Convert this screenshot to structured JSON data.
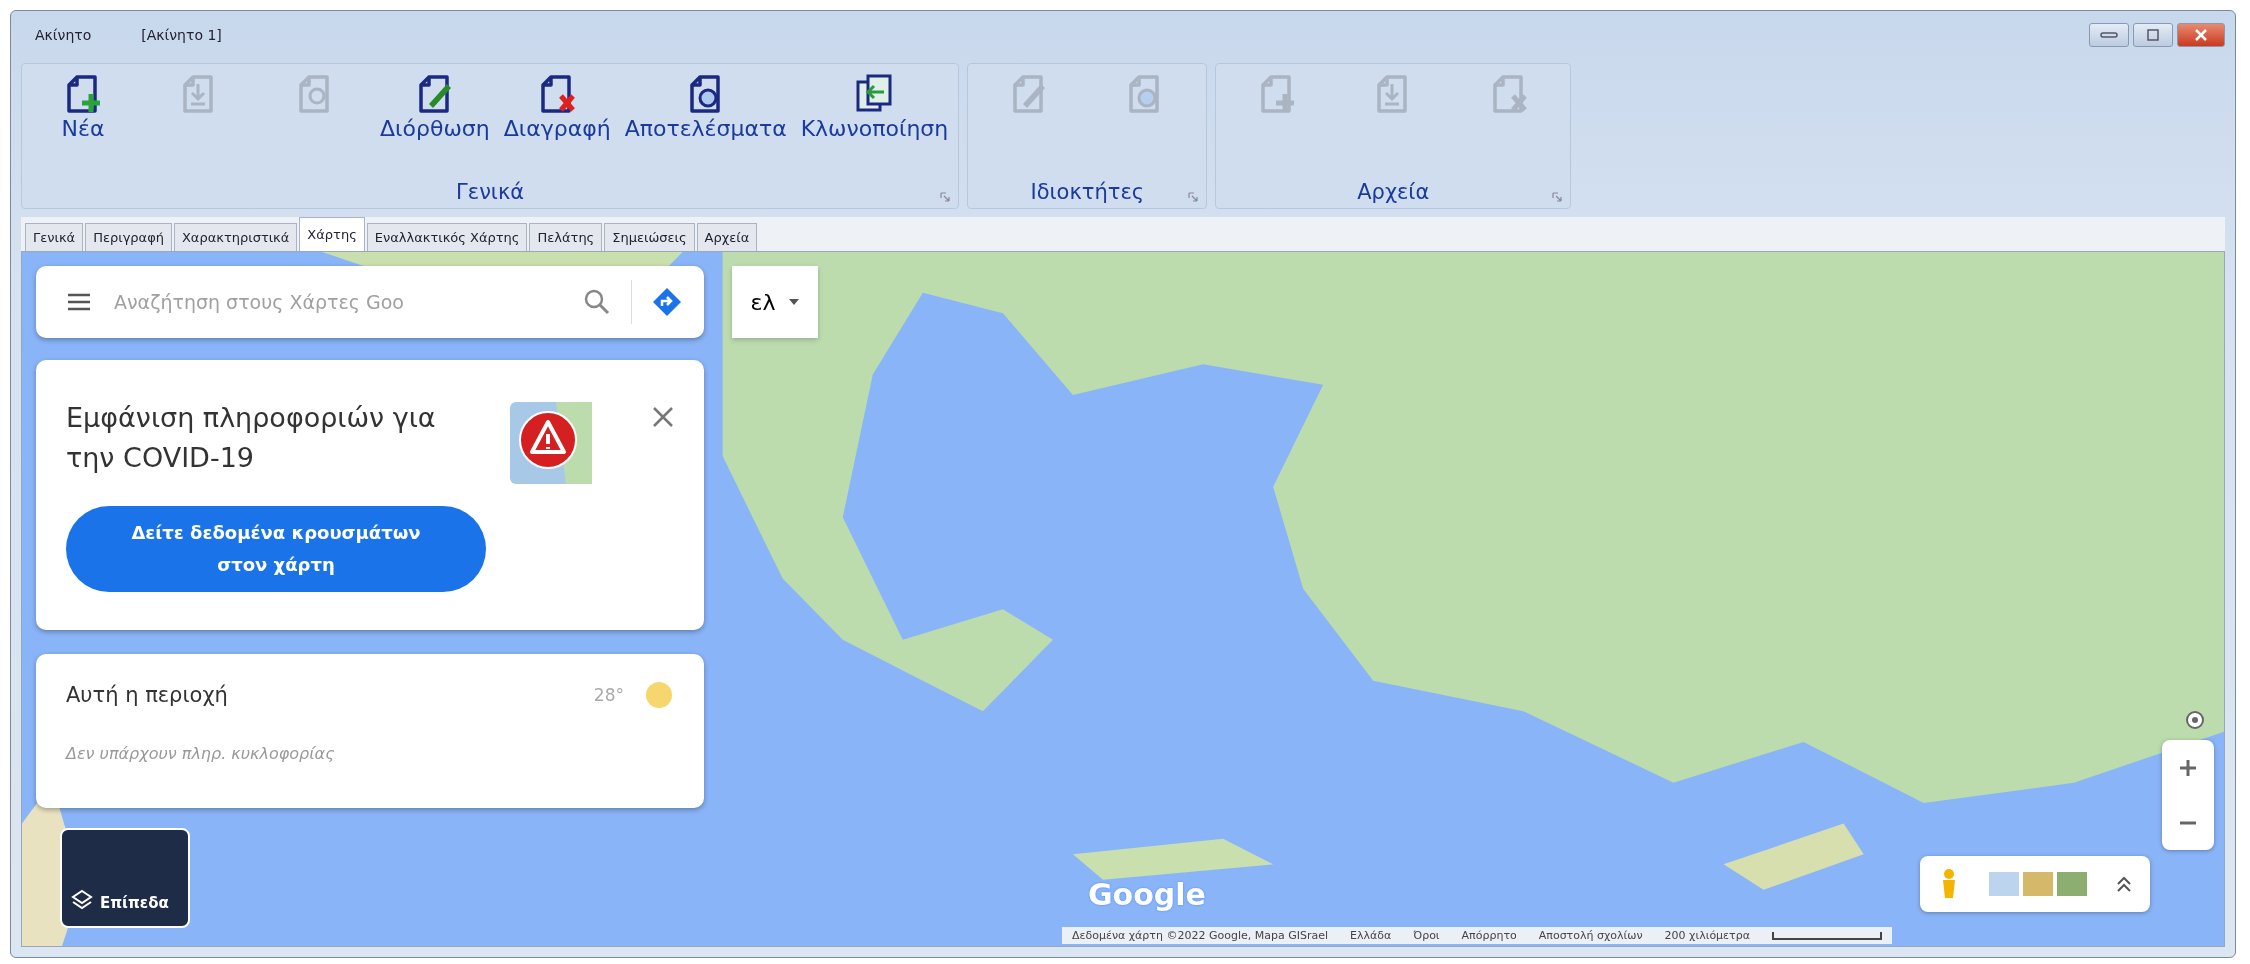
{
  "title_bar": {
    "items": [
      "Ακίνητο",
      "[Ακίνητο 1]"
    ]
  },
  "ribbon": {
    "groups": [
      {
        "label": "Γενικά",
        "buttons": [
          {
            "kind": "new",
            "label": "Νέα",
            "disabled": false
          },
          {
            "kind": "download",
            "disabled": true
          },
          {
            "kind": "cancel",
            "disabled": true
          },
          {
            "kind": "edit",
            "label": "Διόρθωση",
            "disabled": false
          },
          {
            "kind": "delete",
            "label": "Διαγραφή",
            "disabled": false
          },
          {
            "kind": "results",
            "label": "Αποτελέσματα",
            "disabled": false
          },
          {
            "kind": "clone",
            "label": "Κλωνοποίηση",
            "disabled": false
          }
        ]
      },
      {
        "label": "Ιδιοκτήτες",
        "buttons": [
          {
            "kind": "edit",
            "disabled": true
          },
          {
            "kind": "search",
            "disabled": true
          }
        ]
      },
      {
        "label": "Αρχεία",
        "buttons": [
          {
            "kind": "new",
            "disabled": true
          },
          {
            "kind": "download",
            "disabled": true
          },
          {
            "kind": "delete",
            "disabled": true
          }
        ]
      }
    ]
  },
  "tabs": [
    {
      "label": "Γενικά",
      "selected": false
    },
    {
      "label": "Περιγραφή",
      "selected": false
    },
    {
      "label": "Χαρακτηριστικά",
      "selected": false
    },
    {
      "label": "Χάρτης",
      "selected": true
    },
    {
      "label": "Εναλλακτικός Χάρτης",
      "selected": false
    },
    {
      "label": "Πελάτης",
      "selected": false
    },
    {
      "label": "Σημειώσεις",
      "selected": false
    },
    {
      "label": "Αρχεία",
      "selected": false
    }
  ],
  "map": {
    "search": {
      "placeholder": "Αναζήτηση στους Χάρτες Goo"
    },
    "language": "ελ",
    "covid_card": {
      "title": "Εμφάνιση πληροφοριών για την COVID-19",
      "button": "Δείτε δεδομένα κρουσμάτων στον χάρτη"
    },
    "area_card": {
      "title": "Αυτή η περιοχή",
      "temperature": "28°",
      "note": "Δεν υπάρχουν πληρ. κυκλοφορίας"
    },
    "layers": "Επίπεδα",
    "logo": "Google",
    "attribution": [
      "Δεδομένα χάρτη ©2022 Google, Mapa GISrael",
      "Ελλάδα",
      "Όροι",
      "Απόρρητο",
      "Αποστολή σχολίων"
    ],
    "scale": "200 χιλιόμετρα"
  }
}
